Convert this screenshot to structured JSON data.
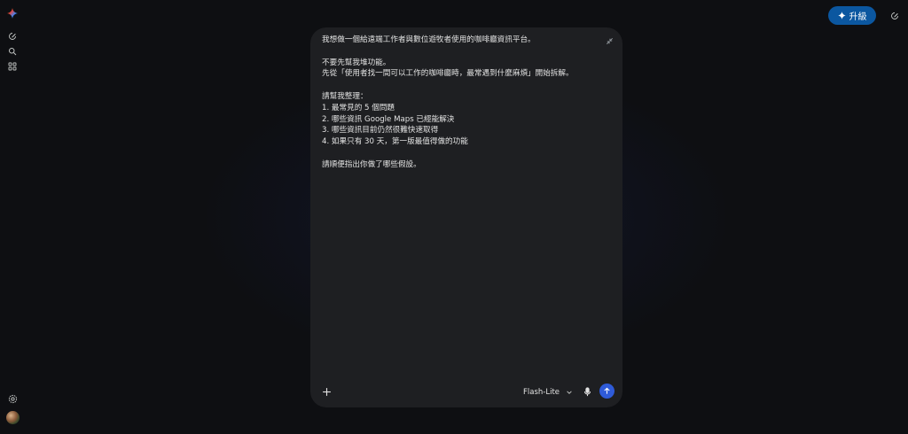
{
  "header": {
    "upgrade_label": "升級"
  },
  "sidebar": {
    "icons": [
      "gemini-logo-icon",
      "new-chat-icon",
      "search-icon",
      "apps-icon"
    ],
    "bottom_icons": [
      "settings-icon",
      "avatar"
    ]
  },
  "prompt": {
    "text": "我想做一個給遠端工作者與數位遊牧者使用的咖啡廳資訊平台。\n\n不要先幫我堆功能。\n先從「使用者找一間可以工作的咖啡廳時，最常遇到什麼麻煩」開始拆解。\n\n請幫我整理：\n1. 最常見的 5 個問題\n2. 哪些資訊 Google Maps 已經能解決\n3. 哪些資訊目前仍然很難快速取得\n4. 如果只有 30 天，第一版最值得做的功能\n\n請順便指出你做了哪些假設。"
  },
  "composer": {
    "model_label": "Flash-Lite"
  },
  "colors": {
    "background": "#0e0f12",
    "card": "#1e1f22",
    "upgrade_button": "#0b57a0",
    "send_button": "#2f5bd8"
  }
}
